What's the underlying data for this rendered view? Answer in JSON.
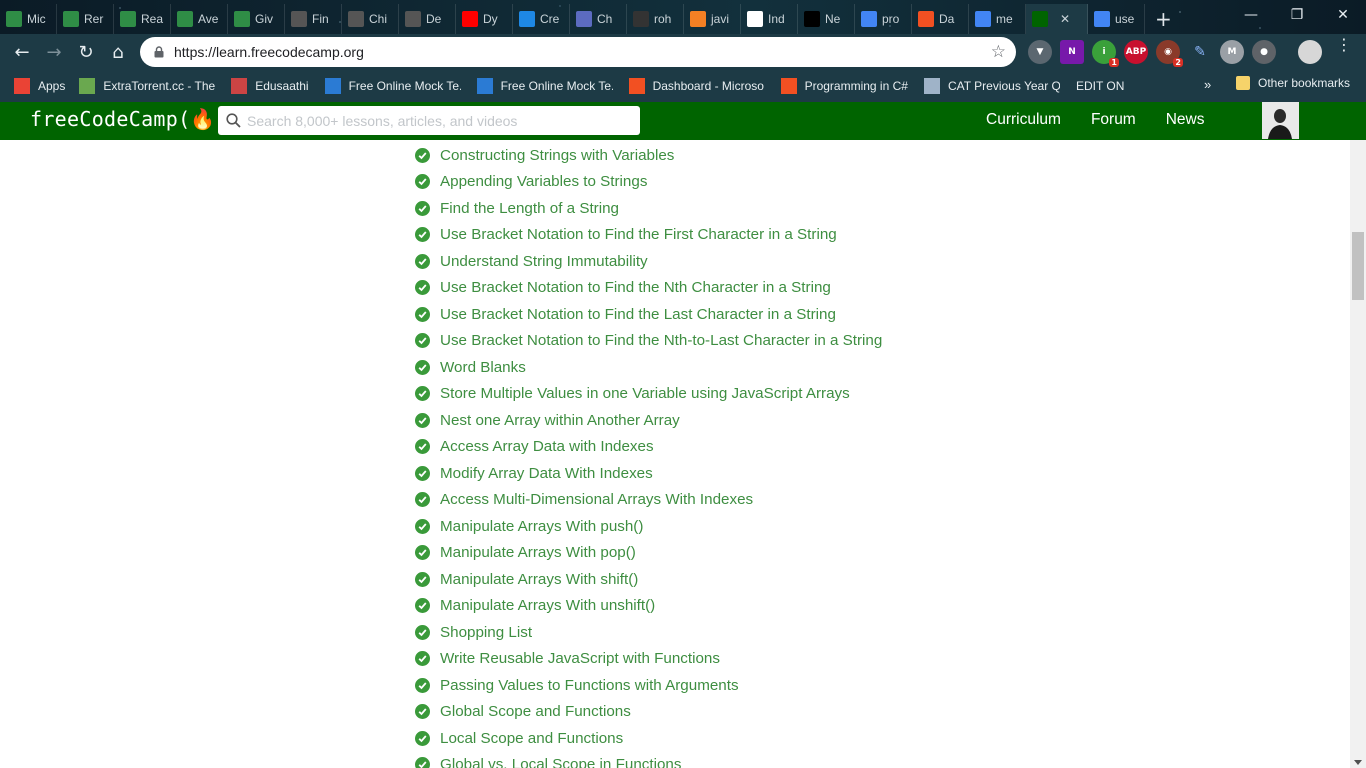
{
  "browser": {
    "tabs": [
      {
        "title": "Mic",
        "icon": "geeksforgeeks-icon",
        "color": "#2f8d46"
      },
      {
        "title": "Rer",
        "icon": "geeksforgeeks-icon",
        "color": "#2f8d46"
      },
      {
        "title": "Rea",
        "icon": "geeksforgeeks-icon",
        "color": "#2f8d46"
      },
      {
        "title": "Ave",
        "icon": "geeksforgeeks-icon",
        "color": "#2f8d46"
      },
      {
        "title": "Giv",
        "icon": "geeksforgeeks-icon",
        "color": "#2f8d46"
      },
      {
        "title": "Fin",
        "icon": "td-icon",
        "color": "#555555"
      },
      {
        "title": "Chi",
        "icon": "td-icon",
        "color": "#555555"
      },
      {
        "title": "De",
        "icon": "td-icon",
        "color": "#555555"
      },
      {
        "title": "Dy",
        "icon": "youtube-icon",
        "color": "#ff0000"
      },
      {
        "title": "Cre",
        "icon": "dollar-icon",
        "color": "#1e88e5"
      },
      {
        "title": "Ch",
        "icon": "visual-studio-icon",
        "color": "#5c6bc0"
      },
      {
        "title": "roh",
        "icon": "github-icon",
        "color": "#333333"
      },
      {
        "title": "javi",
        "icon": "stackoverflow-icon",
        "color": "#f48024"
      },
      {
        "title": "Ind",
        "icon": "document-icon",
        "color": "#ffffff"
      },
      {
        "title": "Ne",
        "icon": "medium-icon",
        "color": "#000000"
      },
      {
        "title": "pro",
        "icon": "google-icon",
        "color": "#4285f4"
      },
      {
        "title": "Da",
        "icon": "microsoft-icon",
        "color": "#f25022"
      },
      {
        "title": "me",
        "icon": "google-icon",
        "color": "#4285f4"
      },
      {
        "title": "",
        "icon": "freecodecamp-icon",
        "color": "#006400",
        "active": true
      },
      {
        "title": "use",
        "icon": "google-icon",
        "color": "#4285f4"
      }
    ],
    "url": "https://learn.freecodecamp.org",
    "bookmarks": [
      {
        "label": "Apps",
        "icon": "apps-grid-icon"
      },
      {
        "label": "ExtraTorrent.cc - The",
        "icon": "extratorrent-icon"
      },
      {
        "label": "Edusaathi",
        "icon": "edusaathi-icon"
      },
      {
        "label": "Free Online Mock Te...",
        "icon": "mock-test-icon"
      },
      {
        "label": "Free Online Mock Te...",
        "icon": "mock-test-icon"
      },
      {
        "label": "Dashboard - Microso...",
        "icon": "microsoft-icon"
      },
      {
        "label": "Programming in C#",
        "icon": "microsoft-icon"
      },
      {
        "label": "CAT Previous Year Q...",
        "icon": "list-icon"
      },
      {
        "label": "EDIT ON",
        "icon": ""
      }
    ],
    "more_bookmarks": "»",
    "other_bookmarks": "Other bookmarks",
    "extension_badges": {
      "first": "1",
      "second": "2"
    }
  },
  "fcc": {
    "logo": "freeCodeCamp(🔥)",
    "search_placeholder": "Search 8,000+ lessons, articles, and videos",
    "nav": [
      "Curriculum",
      "Forum",
      "News"
    ]
  },
  "lessons": [
    "Constructing Strings with Variables",
    "Appending Variables to Strings",
    "Find the Length of a String",
    "Use Bracket Notation to Find the First Character in a String",
    "Understand String Immutability",
    "Use Bracket Notation to Find the Nth Character in a String",
    "Use Bracket Notation to Find the Last Character in a String",
    "Use Bracket Notation to Find the Nth-to-Last Character in a String",
    "Word Blanks",
    "Store Multiple Values in one Variable using JavaScript Arrays",
    "Nest one Array within Another Array",
    "Access Array Data with Indexes",
    "Modify Array Data With Indexes",
    "Access Multi-Dimensional Arrays With Indexes",
    "Manipulate Arrays With push()",
    "Manipulate Arrays With pop()",
    "Manipulate Arrays With shift()",
    "Manipulate Arrays With unshift()",
    "Shopping List",
    "Write Reusable JavaScript with Functions",
    "Passing Values to Functions with Arguments",
    "Global Scope and Functions",
    "Local Scope and Functions",
    "Global vs. Local Scope in Functions"
  ],
  "colors": {
    "fcc_green": "#006400",
    "lesson_link": "#3e8e41",
    "check": "#3a9a3a"
  }
}
